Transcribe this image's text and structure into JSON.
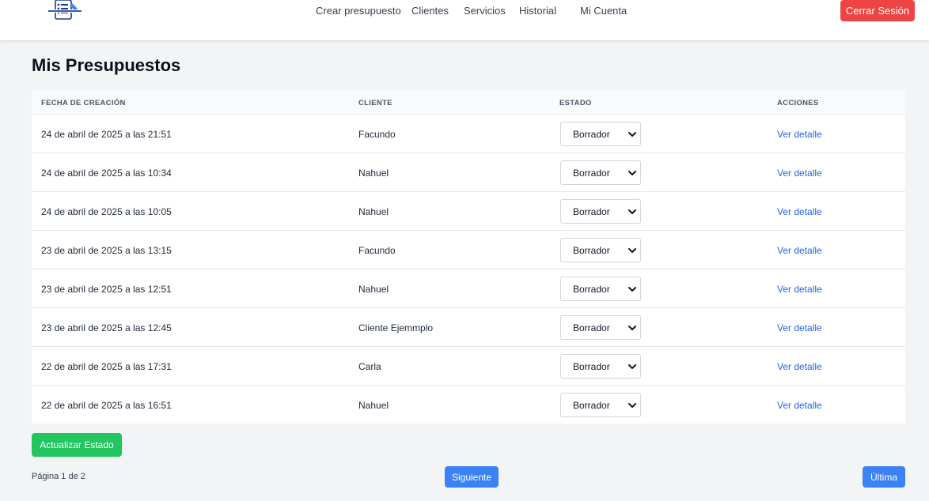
{
  "nav": {
    "links": [
      "Crear presupuesto",
      "Clientes",
      "Servicios",
      "Historial",
      "Mi Cuenta"
    ],
    "logout_label": "Cerrar Sesión",
    "logo_icon": "document-list-icon"
  },
  "page": {
    "title": "Mis Presupuestos"
  },
  "table": {
    "headers": [
      "Fecha de creación",
      "Cliente",
      "Estado",
      "Acciones"
    ],
    "rows": [
      {
        "fecha": "24 de abril de 2025 a las 21:51",
        "cliente": "Facundo",
        "estado": "Borrador",
        "accion": "Ver detalle"
      },
      {
        "fecha": "24 de abril de 2025 a las 10:34",
        "cliente": "Nahuel",
        "estado": "Borrador",
        "accion": "Ver detalle"
      },
      {
        "fecha": "24 de abril de 2025 a las 10:05",
        "cliente": "Nahuel",
        "estado": "Borrador",
        "accion": "Ver detalle"
      },
      {
        "fecha": "23 de abril de 2025 a las 13:15",
        "cliente": "Facundo",
        "estado": "Borrador",
        "accion": "Ver detalle"
      },
      {
        "fecha": "23 de abril de 2025 a las 12:51",
        "cliente": "Nahuel",
        "estado": "Borrador",
        "accion": "Ver detalle"
      },
      {
        "fecha": "23 de abril de 2025 a las 12:45",
        "cliente": "Cliente Ejemmplo",
        "estado": "Borrador",
        "accion": "Ver detalle"
      },
      {
        "fecha": "22 de abril de 2025 a las 17:31",
        "cliente": "Carla",
        "estado": "Borrador",
        "accion": "Ver detalle"
      },
      {
        "fecha": "22 de abril de 2025 a las 16:51",
        "cliente": "Nahuel",
        "estado": "Borrador",
        "accion": "Ver detalle"
      }
    ]
  },
  "actions": {
    "update_label": "Actualizar Estado"
  },
  "pagination": {
    "info": "Página 1 de 2",
    "next_label": "Siguiente",
    "last_label": "Última"
  },
  "colors": {
    "logout": "#ef4444",
    "update": "#22c55e",
    "pagination": "#3b82f6",
    "link": "#2563eb"
  }
}
